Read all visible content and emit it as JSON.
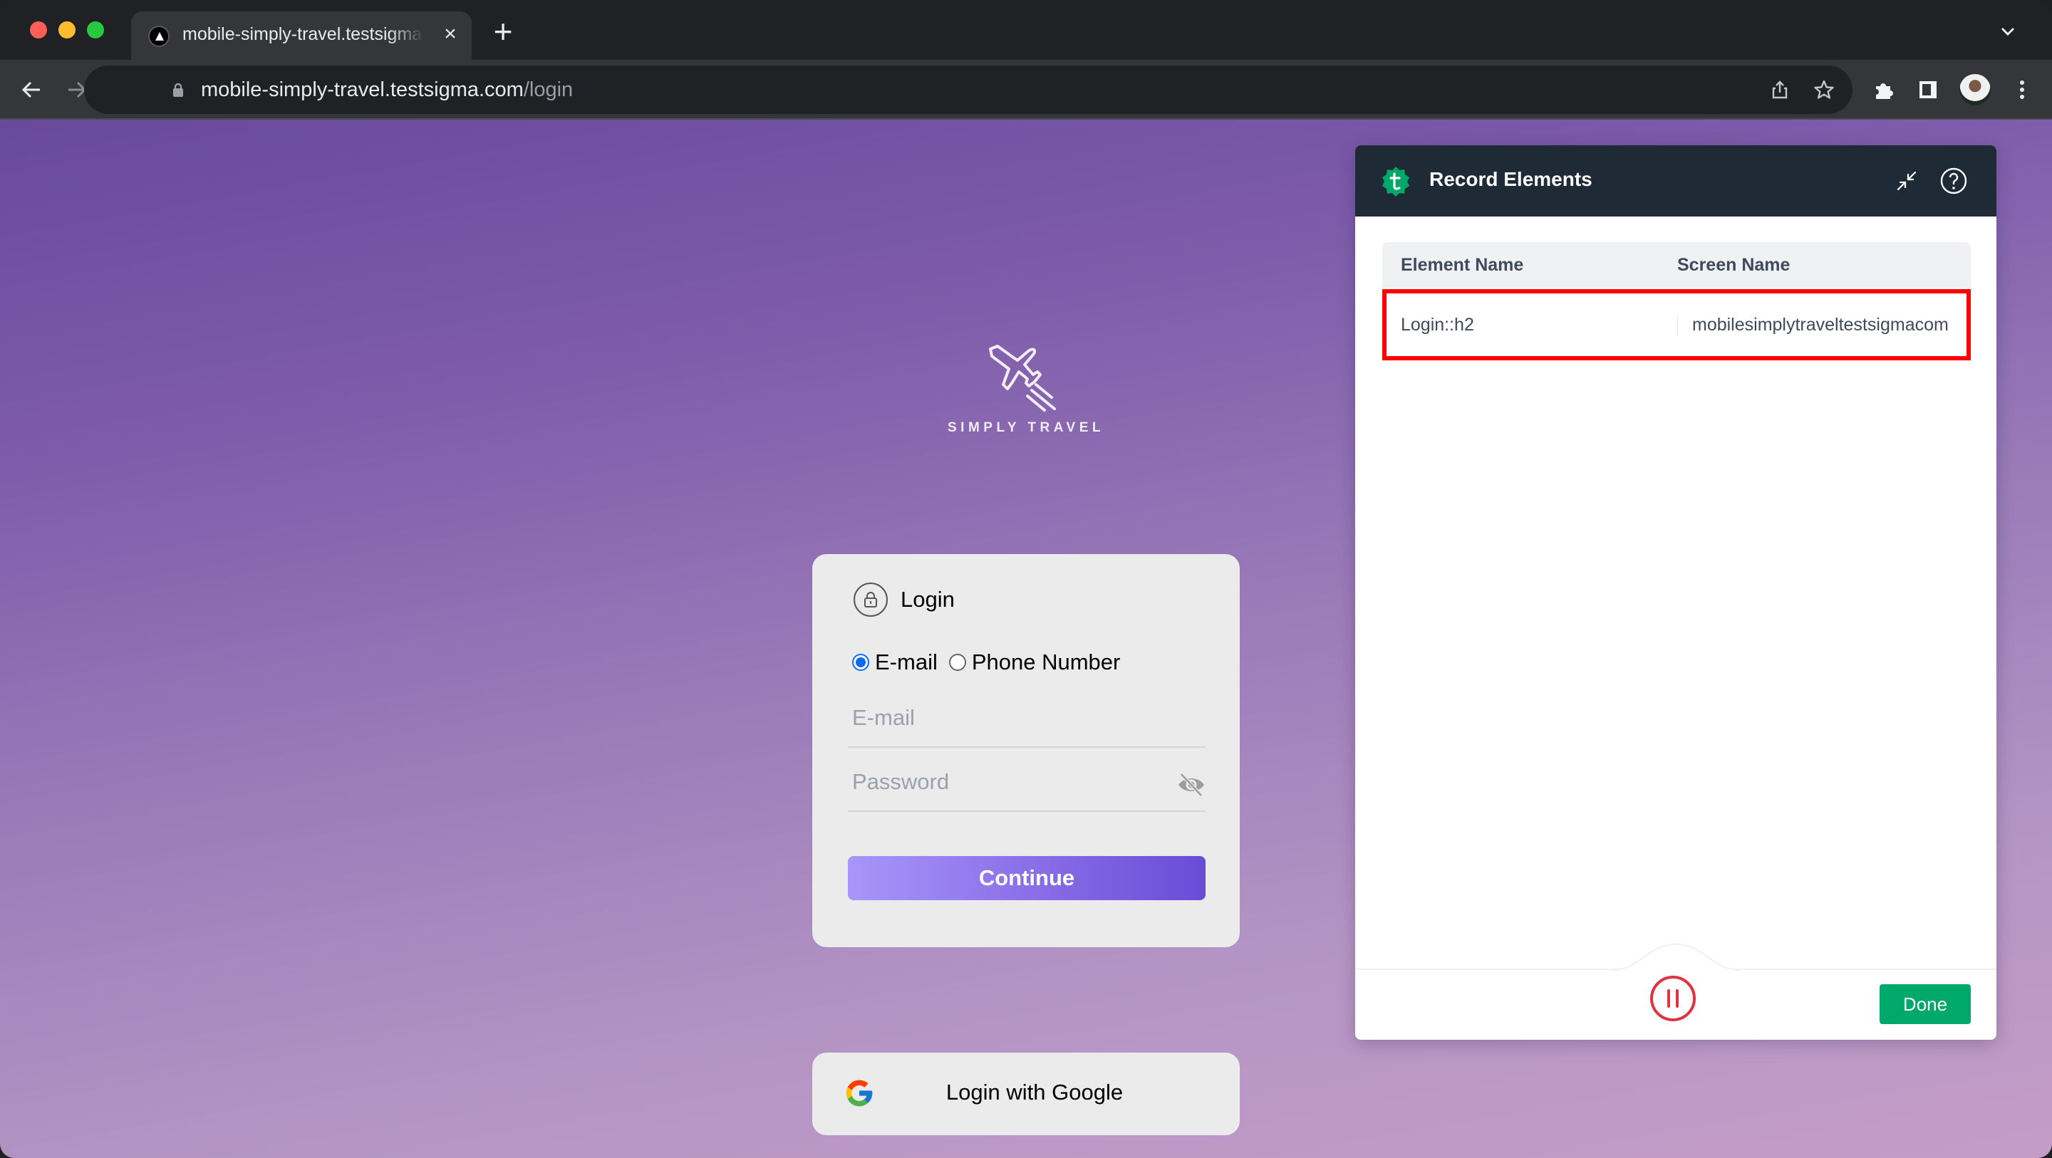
{
  "browser": {
    "tab": {
      "title": "mobile-simply-travel.testsigma.com/login",
      "favicon": "triangle-logo-icon"
    },
    "url": {
      "host": "mobile-simply-travel.testsigma.com",
      "path": "/login"
    },
    "icons": {
      "back": "arrow-left-icon",
      "forward": "arrow-right-icon",
      "reload": "reload-icon",
      "lock": "lock-icon",
      "share": "share-icon",
      "bookmark": "star-icon",
      "extensions": "puzzle-icon",
      "side_panel": "side-panel-icon",
      "profile": "avatar",
      "menu": "kebab-menu-icon",
      "tab_search": "chevron-down-icon",
      "new_tab": "plus-icon",
      "close_tab": "close-icon"
    }
  },
  "app": {
    "logo_text": "SIMPLY TRAVEL",
    "login": {
      "title": "Login",
      "options": [
        {
          "label": "E-mail",
          "checked": true
        },
        {
          "label": "Phone Number",
          "checked": false
        }
      ],
      "email_placeholder": "E-mail",
      "email_value": "",
      "password_placeholder": "Password",
      "password_value": "",
      "continue_label": "Continue"
    },
    "google_login_label": "Login with Google"
  },
  "record_panel": {
    "title": "Record Elements",
    "columns": [
      "Element Name",
      "Screen Name"
    ],
    "rows": [
      {
        "element_name": "Login::h2",
        "screen_name": "mobilesimplytraveltestsigmacom",
        "highlighted": true
      }
    ],
    "done_label": "Done",
    "colors": {
      "header": "#1e2a35",
      "brand": "#00a86b",
      "highlight": "#ff0000",
      "pause": "#e0323f"
    }
  }
}
